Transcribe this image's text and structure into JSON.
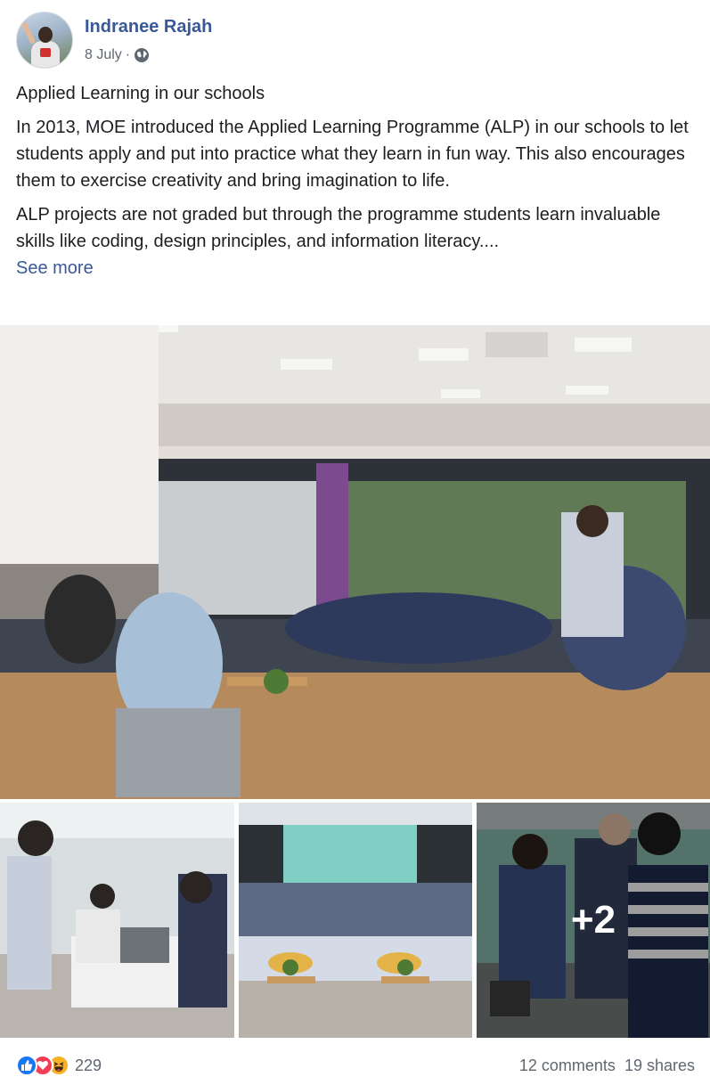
{
  "post": {
    "author": "Indranee Rajah",
    "date": "8 July",
    "separator": "·",
    "privacy_icon": "globe-icon",
    "title_line": "Applied Learning in our schools",
    "paragraph_1": "In 2013, MOE introduced the Applied Learning Programme (ALP) in our schools to let students apply and put into practice what they learn in fun way. This also encourages them to exercise creativity and bring imagination to life.",
    "paragraph_2": "ALP projects are not graded but through the programme students learn invaluable skills like coding, design principles, and information literacy....",
    "see_more": "See more"
  },
  "gallery": {
    "more_count": "+2"
  },
  "footer": {
    "reaction_icons": [
      "like-icon",
      "love-icon",
      "haha-icon"
    ],
    "reaction_count": "229",
    "comments": "12 comments",
    "shares": "19 shares"
  },
  "colors": {
    "link": "#385898",
    "text": "#1c1e21",
    "muted": "#606770",
    "like": "#1877f2",
    "love": "#f33e58",
    "haha": "#f7b125"
  }
}
